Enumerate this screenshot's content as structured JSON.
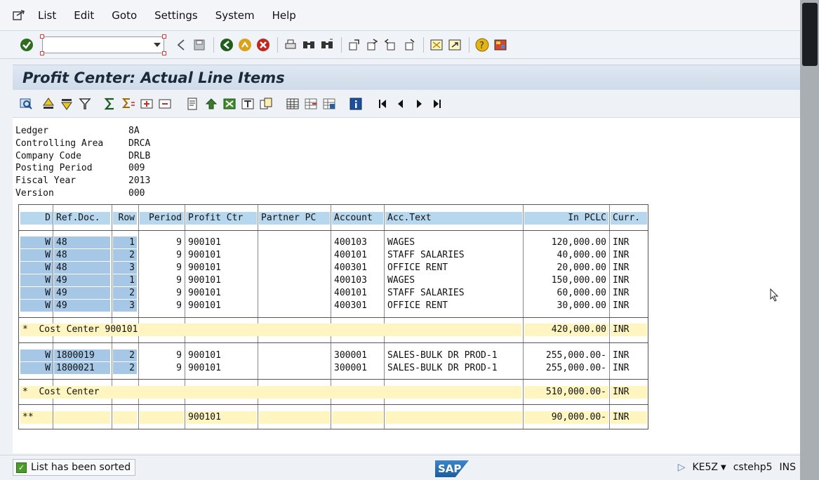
{
  "menu": [
    "List",
    "Edit",
    "Goto",
    "Settings",
    "System",
    "Help"
  ],
  "command_field": {
    "value": ""
  },
  "title": "Profit Center: Actual Line Items",
  "header_info": [
    {
      "label": "Ledger",
      "value": "8A"
    },
    {
      "label": "Controlling Area",
      "value": "DRCA"
    },
    {
      "label": "Company Code",
      "value": "DRLB"
    },
    {
      "label": "Posting Period",
      "value": "009"
    },
    {
      "label": "Fiscal Year",
      "value": "2013"
    },
    {
      "label": "Version",
      "value": "000"
    }
  ],
  "columns": [
    "D",
    "Ref.Doc.",
    "Row",
    "Period",
    "Profit Ctr",
    "Partner PC",
    "Account",
    "Acc.Text",
    "In PCLC",
    "Curr."
  ],
  "rows_group1": [
    {
      "d": "W",
      "ref": "48",
      "row": "1",
      "period": "9",
      "pc": "900101",
      "ppc": "",
      "account": "400103",
      "text": "WAGES",
      "amount": "120,000.00",
      "curr": "INR"
    },
    {
      "d": "W",
      "ref": "48",
      "row": "2",
      "period": "9",
      "pc": "900101",
      "ppc": "",
      "account": "400101",
      "text": "STAFF SALARIES",
      "amount": "40,000.00",
      "curr": "INR"
    },
    {
      "d": "W",
      "ref": "48",
      "row": "3",
      "period": "9",
      "pc": "900101",
      "ppc": "",
      "account": "400301",
      "text": "OFFICE RENT",
      "amount": "20,000.00",
      "curr": "INR"
    },
    {
      "d": "W",
      "ref": "49",
      "row": "1",
      "period": "9",
      "pc": "900101",
      "ppc": "",
      "account": "400103",
      "text": "WAGES",
      "amount": "150,000.00",
      "curr": "INR"
    },
    {
      "d": "W",
      "ref": "49",
      "row": "2",
      "period": "9",
      "pc": "900101",
      "ppc": "",
      "account": "400101",
      "text": "STAFF SALARIES",
      "amount": "60,000.00",
      "curr": "INR"
    },
    {
      "d": "W",
      "ref": "49",
      "row": "3",
      "period": "9",
      "pc": "900101",
      "ppc": "",
      "account": "400301",
      "text": "OFFICE RENT",
      "amount": "30,000.00",
      "curr": "INR"
    }
  ],
  "subtotal1": {
    "label": "*  Cost Center 900101",
    "amount": "420,000.00",
    "curr": "INR"
  },
  "rows_group2": [
    {
      "d": "W",
      "ref": "1800019",
      "row": "2",
      "period": "9",
      "pc": "900101",
      "ppc": "",
      "account": "300001",
      "text": "SALES-BULK DR PROD-1",
      "amount": "255,000.00-",
      "curr": "INR"
    },
    {
      "d": "W",
      "ref": "1800021",
      "row": "2",
      "period": "9",
      "pc": "900101",
      "ppc": "",
      "account": "300001",
      "text": "SALES-BULK DR PROD-1",
      "amount": "255,000.00-",
      "curr": "INR"
    }
  ],
  "subtotal2": {
    "label": "*  Cost Center",
    "amount": "510,000.00-",
    "curr": "INR"
  },
  "total": {
    "label": "**",
    "pc": "900101",
    "amount": "90,000.00-",
    "curr": "INR"
  },
  "status": {
    "message": "List has been sorted",
    "transaction": "KE5Z",
    "server": "cstehp5",
    "mode": "INS"
  },
  "logo_text": "SAP"
}
